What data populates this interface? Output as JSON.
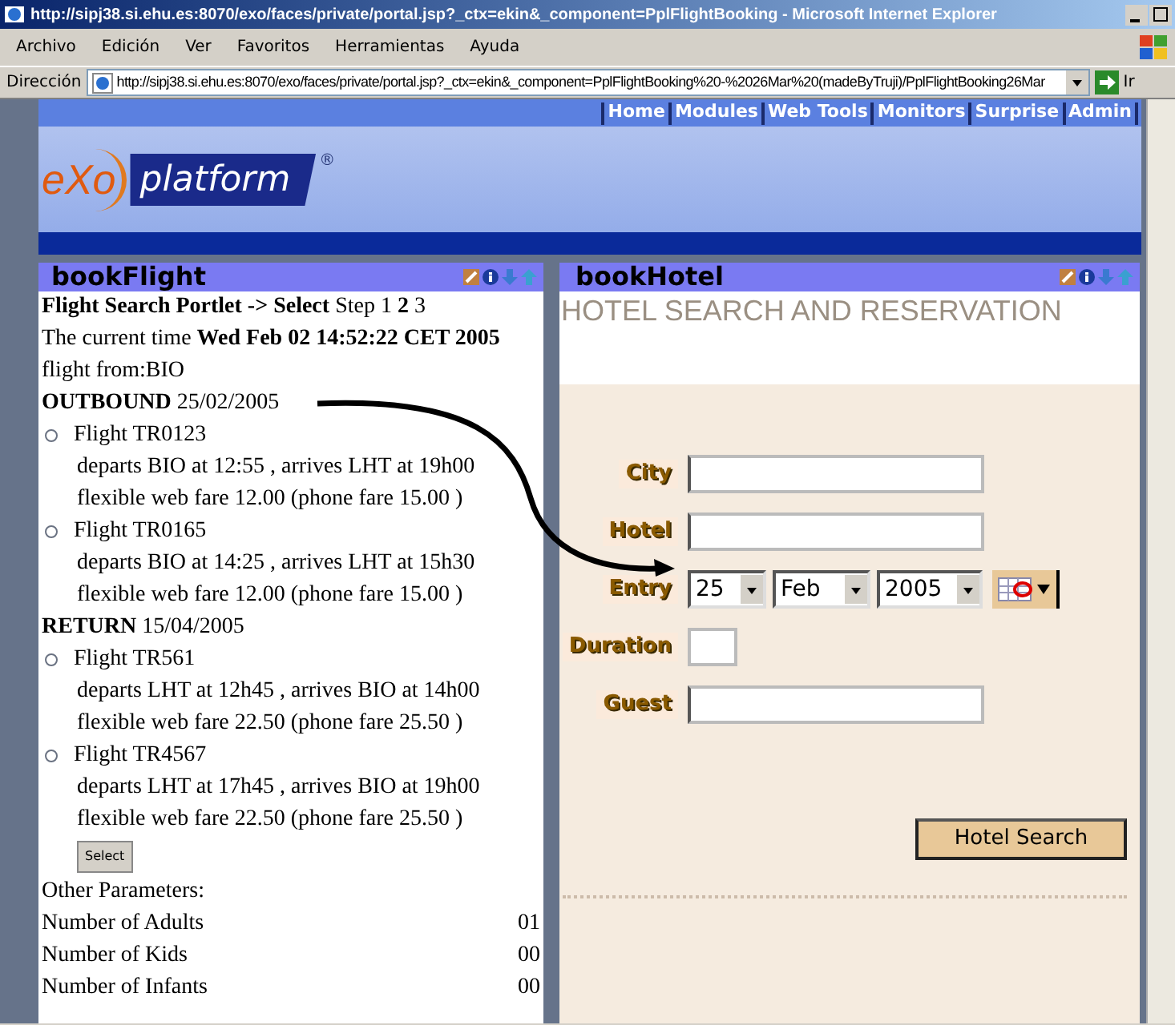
{
  "window": {
    "title": "http://sipj38.si.ehu.es:8070/exo/faces/private/portal.jsp?_ctx=ekin&_component=PplFlightBooking - Microsoft Internet Explorer"
  },
  "menu": [
    "Archivo",
    "Edición",
    "Ver",
    "Favoritos",
    "Herramientas",
    "Ayuda"
  ],
  "address_bar": {
    "label": "Dirección",
    "url": "http://sipj38.si.ehu.es:8070/exo/faces/private/portal.jsp?_ctx=ekin&_component=PplFlightBooking%20-%2026Mar%20(madeByTruji)/PplFlightBooking26Mar",
    "go": "Ir"
  },
  "portal_nav": [
    "Home",
    "Modules",
    "Web Tools",
    "Monitors",
    "Surprise",
    "Admin"
  ],
  "logo": {
    "mark": "eXo",
    "name": "platform",
    "reg": "®"
  },
  "flight_portlet": {
    "title": "bookFlight",
    "lines": [
      "**Flight Search Portlet -> Select** Step 1 **2** 3",
      "The current time **Wed Feb 02 14:52:22 CET 2005**",
      "flight from:BIO"
    ],
    "legs": [
      {
        "heading": "**OUTBOUND** 25/02/2005",
        "flights": [
          {
            "name": "Flight TR0123",
            "selected": false,
            "times": "departs BIO at 12:55 , arrives LHT at 19h00",
            "fare": "flexible web fare 12.00 (phone fare 15.00 )"
          },
          {
            "name": "Flight TR0165",
            "selected": false,
            "times": "departs BIO at 14:25 , arrives LHT at 15h30",
            "fare": "flexible web fare 12.00 (phone fare 15.00 )"
          }
        ]
      },
      {
        "heading": "**RETURN** 15/04/2005",
        "flights": [
          {
            "name": "Flight TR561",
            "selected": false,
            "times": "departs LHT at 12h45 , arrives BIO at 14h00",
            "fare": "flexible web fare 22.50 (phone fare 25.50 )"
          },
          {
            "name": "Flight TR4567",
            "selected": false,
            "times": "departs LHT at 17h45 , arrives BIO at 19h00",
            "fare": "flexible web fare 22.50 (phone fare 25.50 )"
          }
        ]
      }
    ],
    "select_button": "Select",
    "params_heading": "Other Parameters:",
    "params": [
      {
        "label": "Number of Adults",
        "value": "01"
      },
      {
        "label": "Number of Kids",
        "value": "00"
      },
      {
        "label": "Number of Infants",
        "value": "00"
      }
    ]
  },
  "hotel_portlet": {
    "title": "bookHotel",
    "heading": "HOTEL SEARCH AND RESERVATION",
    "fields": [
      {
        "kind": "text",
        "label": "City"
      },
      {
        "kind": "text",
        "label": "Hotel"
      },
      {
        "kind": "date",
        "label": "Entry",
        "day": "25",
        "month": "Feb",
        "year": "2005"
      },
      {
        "kind": "short",
        "label": "Duration"
      },
      {
        "kind": "text",
        "label": "Guest"
      }
    ],
    "search_button": "Hotel Search"
  }
}
